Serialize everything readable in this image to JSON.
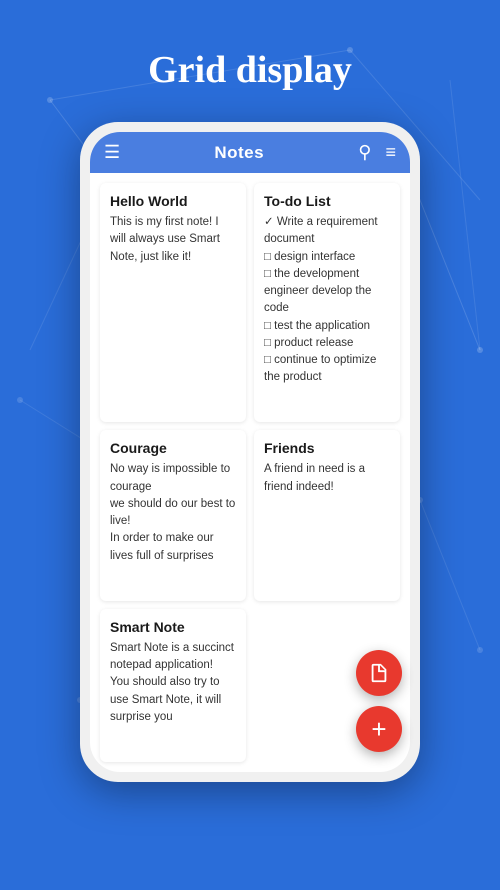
{
  "page": {
    "title": "Grid display",
    "background_color": "#2a6dd9"
  },
  "app": {
    "header": {
      "title": "Notes",
      "menu_icon": "≡",
      "search_icon": "🔍",
      "filter_icon": "≡"
    }
  },
  "notes": [
    {
      "id": "note-hello-world",
      "title": "Hello World",
      "body": "This is my first note! I will always use Smart Note, just like it!"
    },
    {
      "id": "note-todo",
      "title": "To-do List",
      "items": [
        {
          "checked": true,
          "text": "Write a requirement document"
        },
        {
          "checked": false,
          "text": "design interface"
        },
        {
          "checked": false,
          "text": "the development engineer develop the code"
        },
        {
          "checked": false,
          "text": "test the application"
        },
        {
          "checked": false,
          "text": "product release"
        },
        {
          "checked": false,
          "text": "continue to optimize the product"
        }
      ]
    },
    {
      "id": "note-courage",
      "title": "Courage",
      "body": "No way is impossible to courage\nwe should do our best to live!\nIn order to make our lives full of surprises"
    },
    {
      "id": "note-friends",
      "title": "Friends",
      "body": "A friend in need is a friend indeed!"
    },
    {
      "id": "note-smart-note",
      "title": "Smart Note",
      "body": "Smart Note is a succinct notepad application!\nYou should also try to use Smart Note, it will surprise you"
    }
  ],
  "fab": {
    "doc_icon": "📄",
    "add_icon": "+"
  }
}
